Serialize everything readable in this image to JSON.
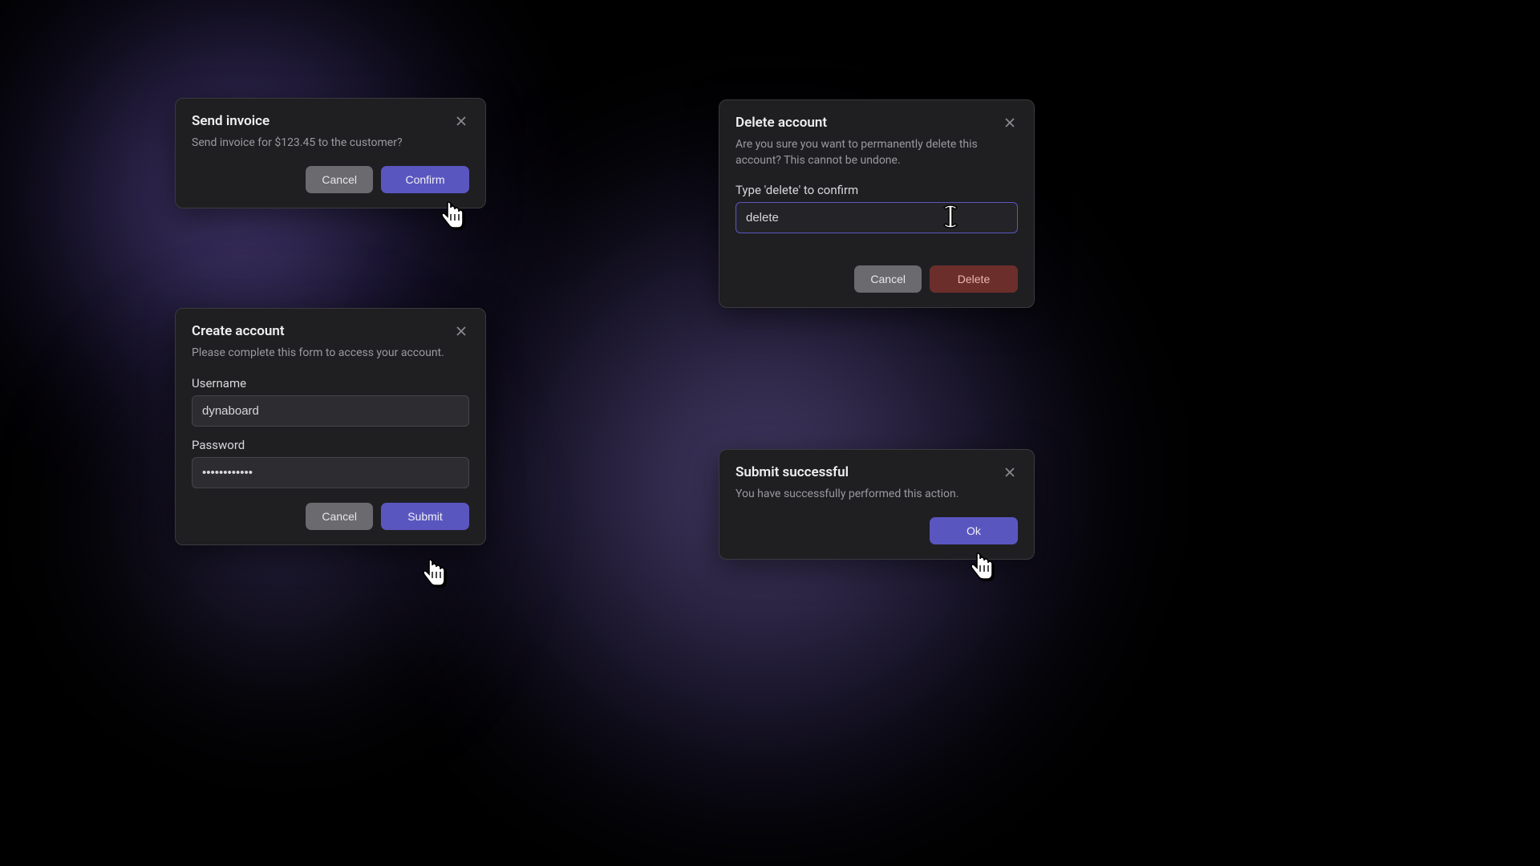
{
  "invoice": {
    "title": "Send invoice",
    "desc": "Send invoice for $123.45 to the customer?",
    "cancel": "Cancel",
    "confirm": "Confirm"
  },
  "create": {
    "title": "Create account",
    "desc": "Please complete this form to access your account.",
    "username_label": "Username",
    "username_value": "dynaboard",
    "password_label": "Password",
    "password_value": "••••••••••••",
    "cancel": "Cancel",
    "submit": "Submit"
  },
  "delete": {
    "title": "Delete account",
    "desc": "Are you sure you want to permanently delete this account? This cannot be undone.",
    "confirm_label": "Type 'delete' to confirm",
    "confirm_value": "delete",
    "cancel": "Cancel",
    "delete": "Delete"
  },
  "success": {
    "title": "Submit successful",
    "desc": "You have successfully performed this action.",
    "ok": "Ok"
  }
}
